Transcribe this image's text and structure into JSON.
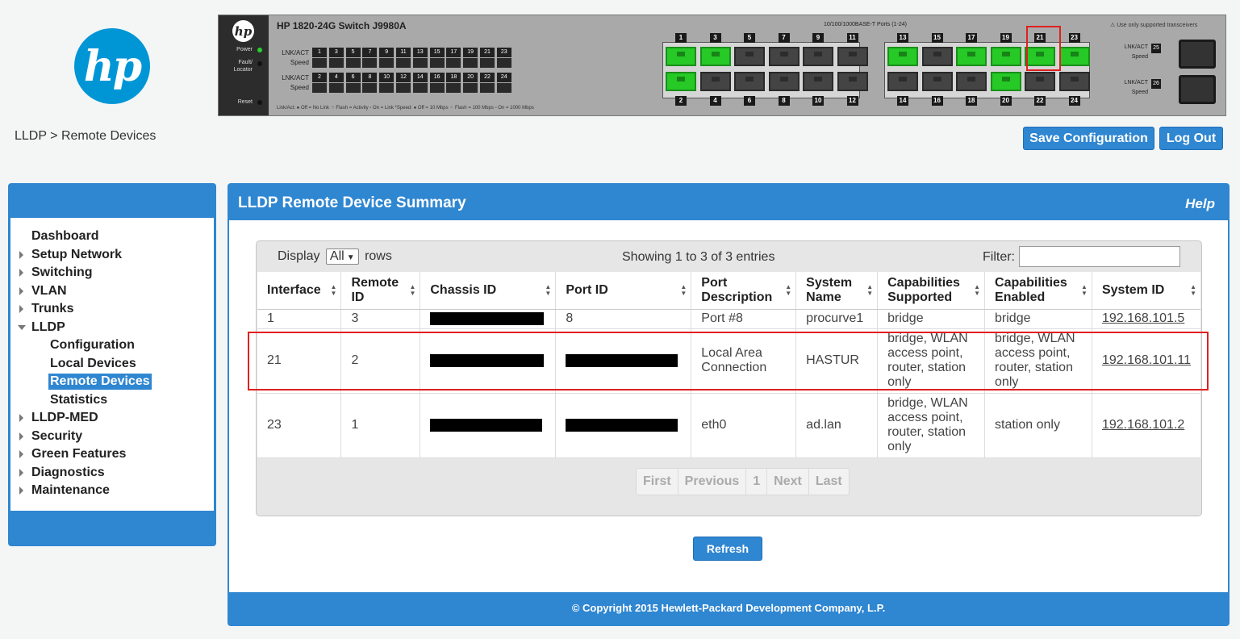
{
  "logo_text": "hp",
  "breadcrumb": "LLDP > Remote Devices",
  "switch": {
    "title": "HP 1820-24G Switch J9980A",
    "ports_caption": "10/100/1000BASE-T Ports (1-24)",
    "transceiver_note": "Use only supported transceivers",
    "labels": {
      "power": "Power",
      "fault": "Fault/ Locator",
      "reset": "Reset",
      "lnk_act": "LNK/ACT",
      "speed": "Speed"
    },
    "legend": "Link/Act:  ● Off = No Link  ⁘ Flash = Activity  ▫ On = Link        *Speed:  ● Off = 10 Mbps  ⁘ Flash = 100 Mbps  ▫ On = 1000 Mbps",
    "mini_top": [
      "1",
      "3",
      "5",
      "7",
      "9",
      "11",
      "13",
      "15",
      "17",
      "19",
      "21",
      "23"
    ],
    "mini_bottom": [
      "2",
      "4",
      "6",
      "8",
      "10",
      "12",
      "14",
      "16",
      "18",
      "20",
      "22",
      "24"
    ],
    "ports_top": [
      {
        "num": "1",
        "active": true
      },
      {
        "num": "3",
        "active": true
      },
      {
        "num": "5",
        "active": false
      },
      {
        "num": "7",
        "active": false
      },
      {
        "num": "9",
        "active": false
      },
      {
        "num": "11",
        "active": false
      },
      {
        "num": "13",
        "active": true
      },
      {
        "num": "15",
        "active": false
      },
      {
        "num": "17",
        "active": true
      },
      {
        "num": "19",
        "active": true
      },
      {
        "num": "21",
        "active": true
      },
      {
        "num": "23",
        "active": true
      }
    ],
    "ports_bottom": [
      {
        "num": "2",
        "active": true
      },
      {
        "num": "4",
        "active": false
      },
      {
        "num": "6",
        "active": false
      },
      {
        "num": "8",
        "active": false
      },
      {
        "num": "10",
        "active": false
      },
      {
        "num": "12",
        "active": false
      },
      {
        "num": "14",
        "active": false
      },
      {
        "num": "16",
        "active": false
      },
      {
        "num": "18",
        "active": false
      },
      {
        "num": "20",
        "active": true
      },
      {
        "num": "22",
        "active": false
      },
      {
        "num": "24",
        "active": false
      }
    ],
    "sfp": [
      "25",
      "26"
    ],
    "colors": {
      "active_port": "#26c926",
      "inactive_port": "#444444"
    }
  },
  "header_buttons": {
    "save": "Save Configuration",
    "logout": "Log Out"
  },
  "sidebar": {
    "items": [
      {
        "label": "Dashboard",
        "arrow": "none"
      },
      {
        "label": "Setup Network",
        "arrow": "right"
      },
      {
        "label": "Switching",
        "arrow": "right"
      },
      {
        "label": "VLAN",
        "arrow": "right"
      },
      {
        "label": "Trunks",
        "arrow": "right"
      },
      {
        "label": "LLDP",
        "arrow": "down"
      },
      {
        "label": "Configuration",
        "sub": true
      },
      {
        "label": "Local Devices",
        "sub": true
      },
      {
        "label": "Remote Devices",
        "sub": true,
        "selected": true
      },
      {
        "label": "Statistics",
        "sub": true
      },
      {
        "label": "LLDP-MED",
        "arrow": "right"
      },
      {
        "label": "Security",
        "arrow": "right"
      },
      {
        "label": "Green Features",
        "arrow": "right"
      },
      {
        "label": "Diagnostics",
        "arrow": "right"
      },
      {
        "label": "Maintenance",
        "arrow": "right"
      }
    ]
  },
  "panel": {
    "title": "LLDP Remote Device Summary",
    "help": "Help",
    "display_label": "Display",
    "display_value": "All",
    "rows_label": "rows",
    "showing": "Showing 1 to 3 of 3 entries",
    "filter_label": "Filter:",
    "columns": [
      "Interface",
      "Remote ID",
      "Chassis ID",
      "Port ID",
      "Port Description",
      "System Name",
      "Capabilities Supported",
      "Capabilities Enabled",
      "System ID"
    ],
    "rows": [
      {
        "interface": "1",
        "remote_id": "3",
        "chassis": "",
        "port_id": "8",
        "port_desc": "Port #8",
        "sys_name": "procurve1",
        "cap_sup": "bridge",
        "cap_en": "bridge",
        "sys_id": "192.168.101.5"
      },
      {
        "interface": "21",
        "remote_id": "2",
        "chassis": "",
        "port_id": "",
        "port_desc": "Local Area Connection",
        "sys_name": "HASTUR",
        "cap_sup": "bridge, WLAN access point, router, station only",
        "cap_en": "bridge, WLAN access point, router, station only",
        "sys_id": "192.168.101.11"
      },
      {
        "interface": "23",
        "remote_id": "1",
        "chassis": "",
        "port_id": "",
        "port_desc": "eth0",
        "sys_name": "ad.lan",
        "cap_sup": "bridge, WLAN access point, router, station only",
        "cap_en": "station only",
        "sys_id": "192.168.101.2"
      }
    ],
    "pager": [
      "First",
      "Previous",
      "1",
      "Next",
      "Last"
    ],
    "refresh": "Refresh",
    "footer": "© Copyright 2015 Hewlett-Packard Development Company, L.P."
  },
  "accent_color": "#2f86d1",
  "highlight_color": "#e02020"
}
